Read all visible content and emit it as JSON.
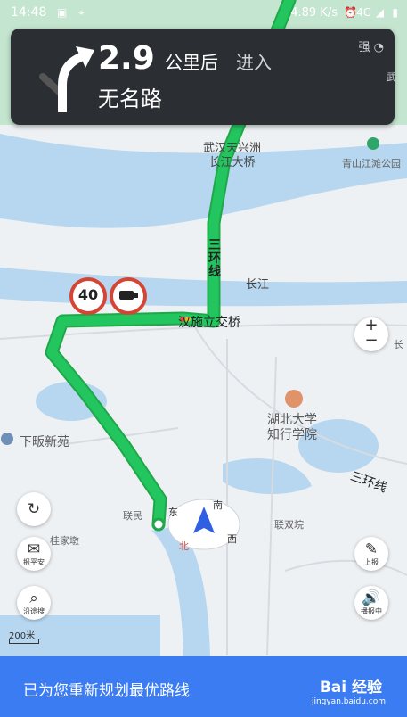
{
  "status_bar": {
    "time": "14:48",
    "speed": "4.89 K/s",
    "network": "4G"
  },
  "guidance": {
    "distance": "2.9",
    "distance_unit": "公里后",
    "action": "进入",
    "road_name": "无名路",
    "gps_signal": "强",
    "turn_icon": "turn-right-arrow-icon"
  },
  "map_labels": {
    "bridge_name": "武汉天兴洲\n长江大桥",
    "bridge_line1": "武汉天兴洲",
    "bridge_line2": "长江大桥",
    "park": "青山江滩公园",
    "ring_vertical": "三\n环\n线",
    "river": "长江",
    "interchange": "汉施立交桥",
    "university_line1": "湖北大学",
    "university_line2": "知行学院",
    "district": "下畈新苑",
    "ring_road": "三环线",
    "village1": "联民",
    "village2": "桂家墩",
    "village3": "联双垸",
    "edge_label": "长",
    "edge_top": "武"
  },
  "speed_limit": "40",
  "compass": {
    "east": "东",
    "south": "南",
    "west": "西",
    "north": "北"
  },
  "side_buttons": {
    "report_safe": "报平安",
    "search_along": "沿途搜",
    "report": "上报",
    "broadcast": "播报中"
  },
  "zoom": {
    "in": "+",
    "out": "−"
  },
  "scale_label": "200米",
  "toast": {
    "message": "已为您重新规划最优路线"
  },
  "watermark": {
    "brand": "Bai 经验",
    "site": "jingyan.baidu.com"
  },
  "colors": {
    "route": "#22c55e",
    "river": "#b6d7ef",
    "card": "#2b2f33",
    "toast": "#3b7cf3"
  }
}
